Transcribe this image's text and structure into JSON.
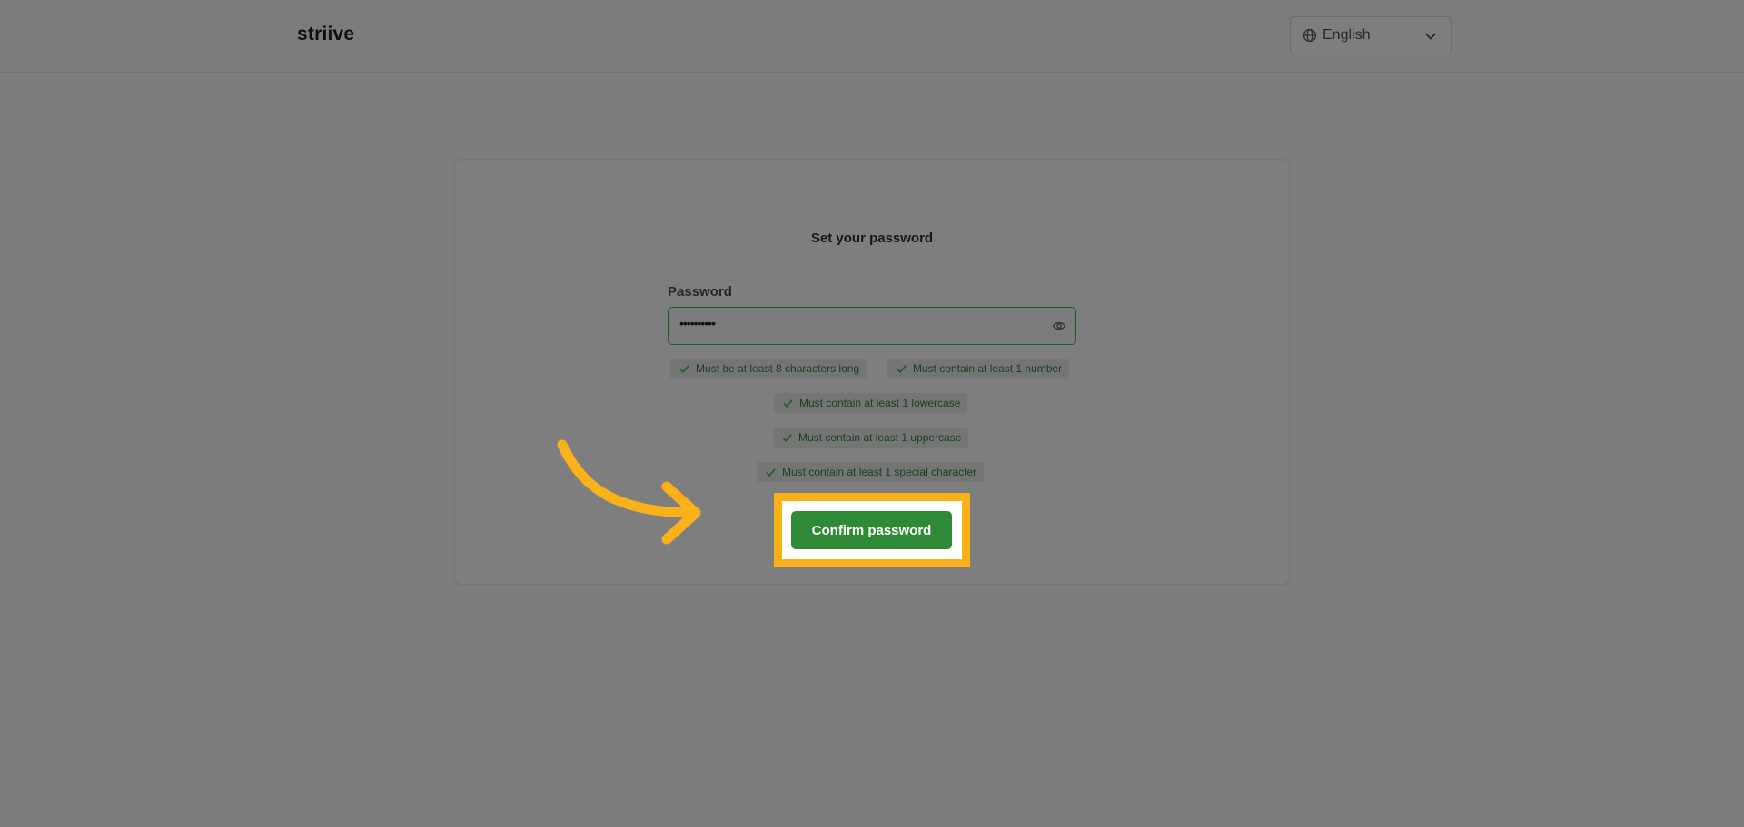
{
  "header": {
    "logo": "striive",
    "language": {
      "selected": "English",
      "icon": "globe-icon",
      "dropdown_icon": "chevron-down-icon"
    }
  },
  "form": {
    "title": "Set your password",
    "password_label": "Password",
    "password_value": "••••••••••",
    "visibility_icon": "eye-icon",
    "rules": [
      {
        "text": "Must be at least 8 characters long",
        "met": true
      },
      {
        "text": "Must contain at least 1 number",
        "met": true
      },
      {
        "text": "Must contain at least 1 lowercase",
        "met": true
      },
      {
        "text": "Must contain at least 1 uppercase",
        "met": true
      },
      {
        "text": "Must contain at least 1 special character",
        "met": true
      }
    ],
    "submit_label": "Confirm password"
  },
  "colors": {
    "overlay_background": "#7c7c7c",
    "primary_button": "#2e8a36",
    "highlight": "#fbb21a",
    "check": "#1e5a22"
  }
}
